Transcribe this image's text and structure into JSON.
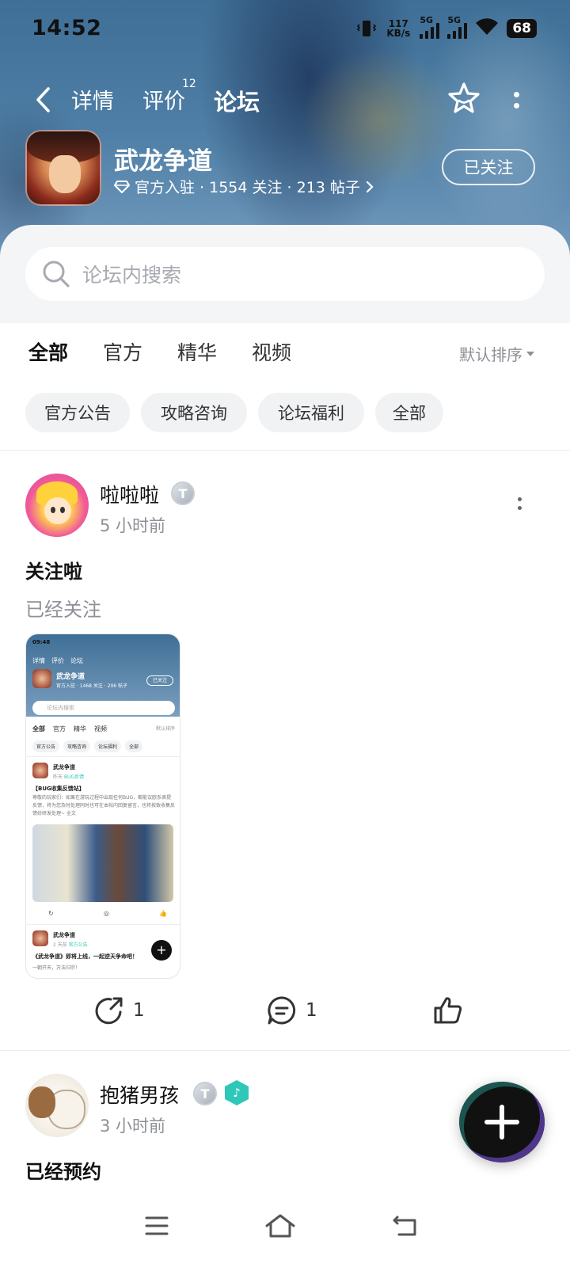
{
  "status_bar": {
    "time": "14:52",
    "net_speed_top": "117",
    "net_speed_bottom": "KB/s",
    "signal1_label": "5G",
    "signal2_label": "5G",
    "battery": "68"
  },
  "nav": {
    "tabs": [
      {
        "label": "详情",
        "active": false
      },
      {
        "label": "评价",
        "active": false
      },
      {
        "label": "论坛",
        "active": true
      }
    ],
    "review_count": "12",
    "icons": [
      "back-icon",
      "star-icon",
      "more-vertical-icon"
    ]
  },
  "game": {
    "name": "武龙争道",
    "meta": "官方入驻 · 1554 关注 · 213 帖子",
    "follow_label": "已关注"
  },
  "search": {
    "placeholder": "论坛内搜索"
  },
  "filter_tabs": [
    {
      "label": "全部",
      "active": true
    },
    {
      "label": "官方",
      "active": false
    },
    {
      "label": "精华",
      "active": false
    },
    {
      "label": "视频",
      "active": false
    }
  ],
  "sort_label": "默认排序",
  "chips": [
    "官方公告",
    "攻略咨询",
    "论坛福利",
    "全部"
  ],
  "posts": [
    {
      "user": "啦啦啦",
      "level": "T",
      "time": "5 小时前",
      "title": "关注啦",
      "body": "已经关注",
      "share_count": "1",
      "comment_count": "1",
      "thumbnail": {
        "time": "09:48",
        "nav": [
          "详情",
          "评价",
          "论坛"
        ],
        "game_name": "武龙争道",
        "game_meta": "官方入驻 · 1468 关注 · 206 帖子",
        "follow": "已关注",
        "search": "论坛内搜索",
        "tabs": [
          "全部",
          "官方",
          "精华",
          "视频"
        ],
        "sort": "默认排序",
        "chips": [
          "官方公告",
          "攻略咨询",
          "论坛福利",
          "全部"
        ],
        "post1_name": "武龙争道",
        "post1_time": "昨天",
        "post1_tag": "BUG反馈",
        "post1_title": "【BUG收集反馈站】",
        "post1_body": "尊敬的玩家们：如果在游玩过程中出现任何BUG，都能议欧系表提反馈，将为您及时处理同时也可在本帖内回复留言，也将按致收集反馈纷研发处理~ 全文",
        "post2_name": "武龙争道",
        "post2_time": "2 天前",
        "post2_tag": "官方公告",
        "post2_title": "《武龙争道》即将上线，一起逆天争命吧！",
        "post2_body": "一朝开天，万法归宗！"
      }
    },
    {
      "user": "抱猪男孩",
      "level": "T",
      "time": "3 小时前",
      "title": "已经预约"
    }
  ],
  "colors": {
    "accent": "#2fd4c4",
    "header_bg": "#4f7fa6",
    "muted_text": "#8d9096",
    "chip_bg": "#f0f2f4"
  }
}
